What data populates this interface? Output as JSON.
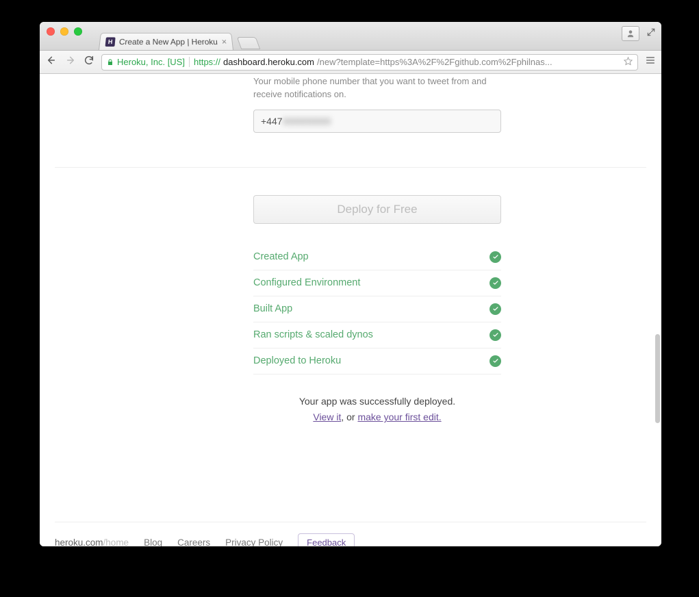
{
  "browser": {
    "tab_title": "Create a New App | Heroku",
    "ev_label": "Heroku, Inc. [US]",
    "url_protocol": "https://",
    "url_host": "dashboard.heroku.com",
    "url_path": "/new?template=https%3A%2F%2Fgithub.com%2Fphilnas..."
  },
  "form": {
    "phone_description": "Your mobile phone number that you want to tweet from and receive notifications on.",
    "phone_value_visible": "+447",
    "phone_value_masked": "00000000"
  },
  "deploy": {
    "button_label": "Deploy for Free",
    "steps": [
      "Created App",
      "Configured Environment",
      "Built App",
      "Ran scripts & scaled dynos",
      "Deployed to Heroku"
    ],
    "success_line": "Your app was successfully deployed.",
    "link_view": "View it",
    "mid_text": ", or ",
    "link_edit": "make your first edit."
  },
  "footer": {
    "brand_prefix": "heroku.com",
    "brand_suffix": "/home",
    "links": [
      "Blog",
      "Careers",
      "Privacy Policy"
    ],
    "feedback_label": "Feedback"
  }
}
